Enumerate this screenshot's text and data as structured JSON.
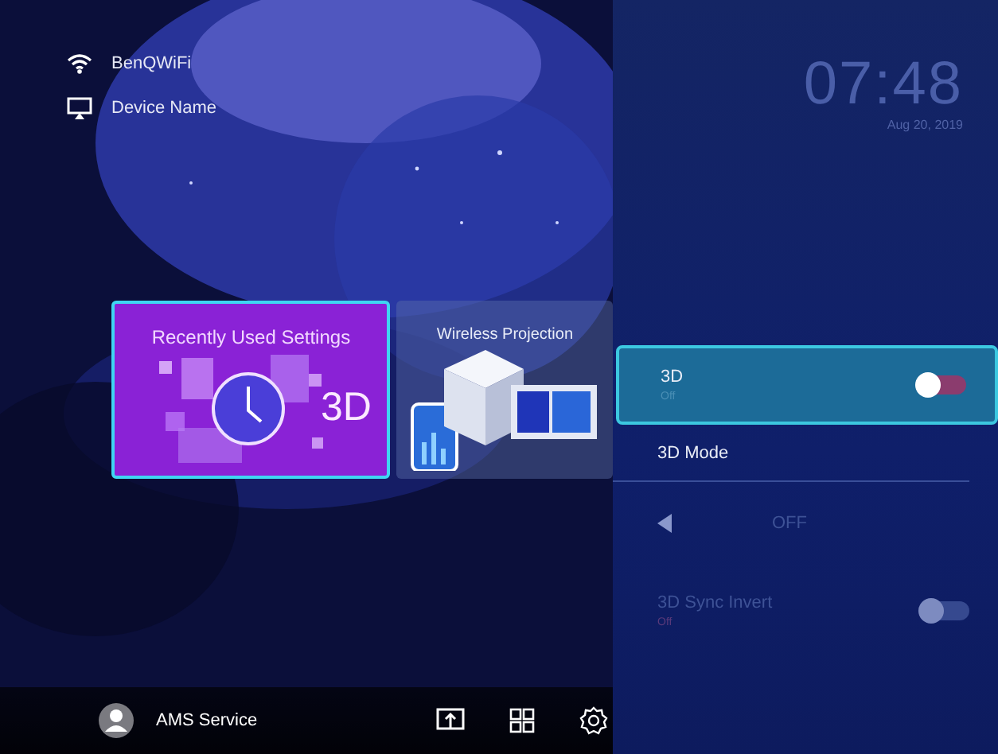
{
  "status": {
    "wifi": "BenQWiFi",
    "device": "Device Name"
  },
  "clock": {
    "time": "07:48",
    "date": "Aug 20, 2019"
  },
  "cards": [
    {
      "kind": "recent",
      "title": "Recently Used Settings",
      "badge": "3D",
      "selected": true
    },
    {
      "kind": "wireless",
      "title": "Wireless Projection",
      "selected": false
    }
  ],
  "settings": [
    {
      "kind": "toggle",
      "label": "3D",
      "value": "Off",
      "on": false,
      "selected": true,
      "disabled": false
    },
    {
      "kind": "link",
      "label": "3D Mode",
      "selected": false,
      "disabled": false
    },
    {
      "kind": "choice",
      "value": "OFF",
      "selected": false,
      "disabled": true
    },
    {
      "kind": "toggle",
      "label": "3D Sync Invert",
      "value": "Off",
      "on": false,
      "selected": false,
      "disabled": true
    }
  ],
  "bottom_bar": {
    "account": "AMS Service"
  }
}
